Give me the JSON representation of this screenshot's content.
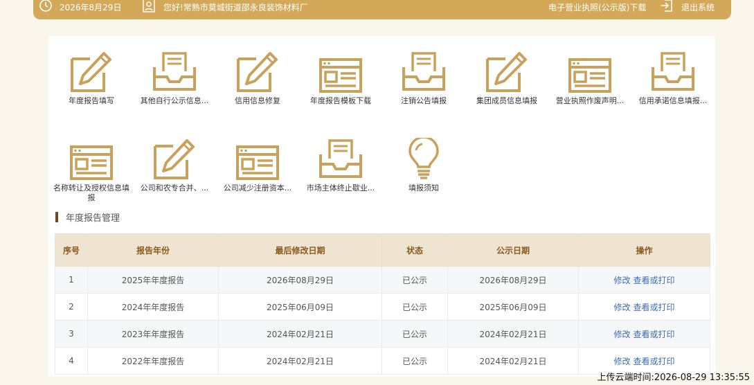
{
  "header": {
    "date": "2026年8月29日",
    "greeting": "您好!常熟市莫城街道邵永良装饰材料厂",
    "license_download": "电子营业执照(公示版)下载",
    "logout": "退出系统"
  },
  "tiles": [
    {
      "label": "年度报告填写",
      "icon": "pencil"
    },
    {
      "label": "其他自行公示信息...",
      "icon": "tray"
    },
    {
      "label": "信用信息修复",
      "icon": "pencil"
    },
    {
      "label": "年度报告模板下载",
      "icon": "form"
    },
    {
      "label": "注销公告填报",
      "icon": "tray"
    },
    {
      "label": "集团成员信息填报",
      "icon": "pencil"
    },
    {
      "label": "营业执照作废声明...",
      "icon": "form"
    },
    {
      "label": "信用承诺信息填报...",
      "icon": "tray"
    },
    {
      "label": "名称转让及授权信息填报",
      "icon": "form"
    },
    {
      "label": "公司和农专合并、...",
      "icon": "pencil"
    },
    {
      "label": "公司减少注册资本...",
      "icon": "form"
    },
    {
      "label": "市场主体终止歇业...",
      "icon": "tray"
    },
    {
      "label": "填报须知",
      "icon": "bulb"
    }
  ],
  "section_title": "年度报告管理",
  "table": {
    "headers": [
      "序号",
      "报告年份",
      "最后修改日期",
      "状态",
      "公示日期",
      "操作"
    ],
    "rows": [
      {
        "no": "1",
        "year": "2025年年度报告",
        "modified": "2026年08月29日",
        "status": "已公示",
        "publish": "2026年08月29日"
      },
      {
        "no": "2",
        "year": "2024年年度报告",
        "modified": "2025年06月09日",
        "status": "已公示",
        "publish": "2025年06月09日"
      },
      {
        "no": "3",
        "year": "2023年年度报告",
        "modified": "2024年02月21日",
        "status": "已公示",
        "publish": "2024年02月21日"
      },
      {
        "no": "4",
        "year": "2022年年度报告",
        "modified": "2024年02月21日",
        "status": "已公示",
        "publish": "2024年02月21日"
      }
    ],
    "action_edit": "修改",
    "action_view": "查看或打印"
  },
  "footer": {
    "upload_time": "上传云端时间:2026-08-29 13:35:55"
  },
  "colors": {
    "gold": "#d3a959",
    "icon_gold": "#c9a15a",
    "link": "#3d6bb2"
  }
}
